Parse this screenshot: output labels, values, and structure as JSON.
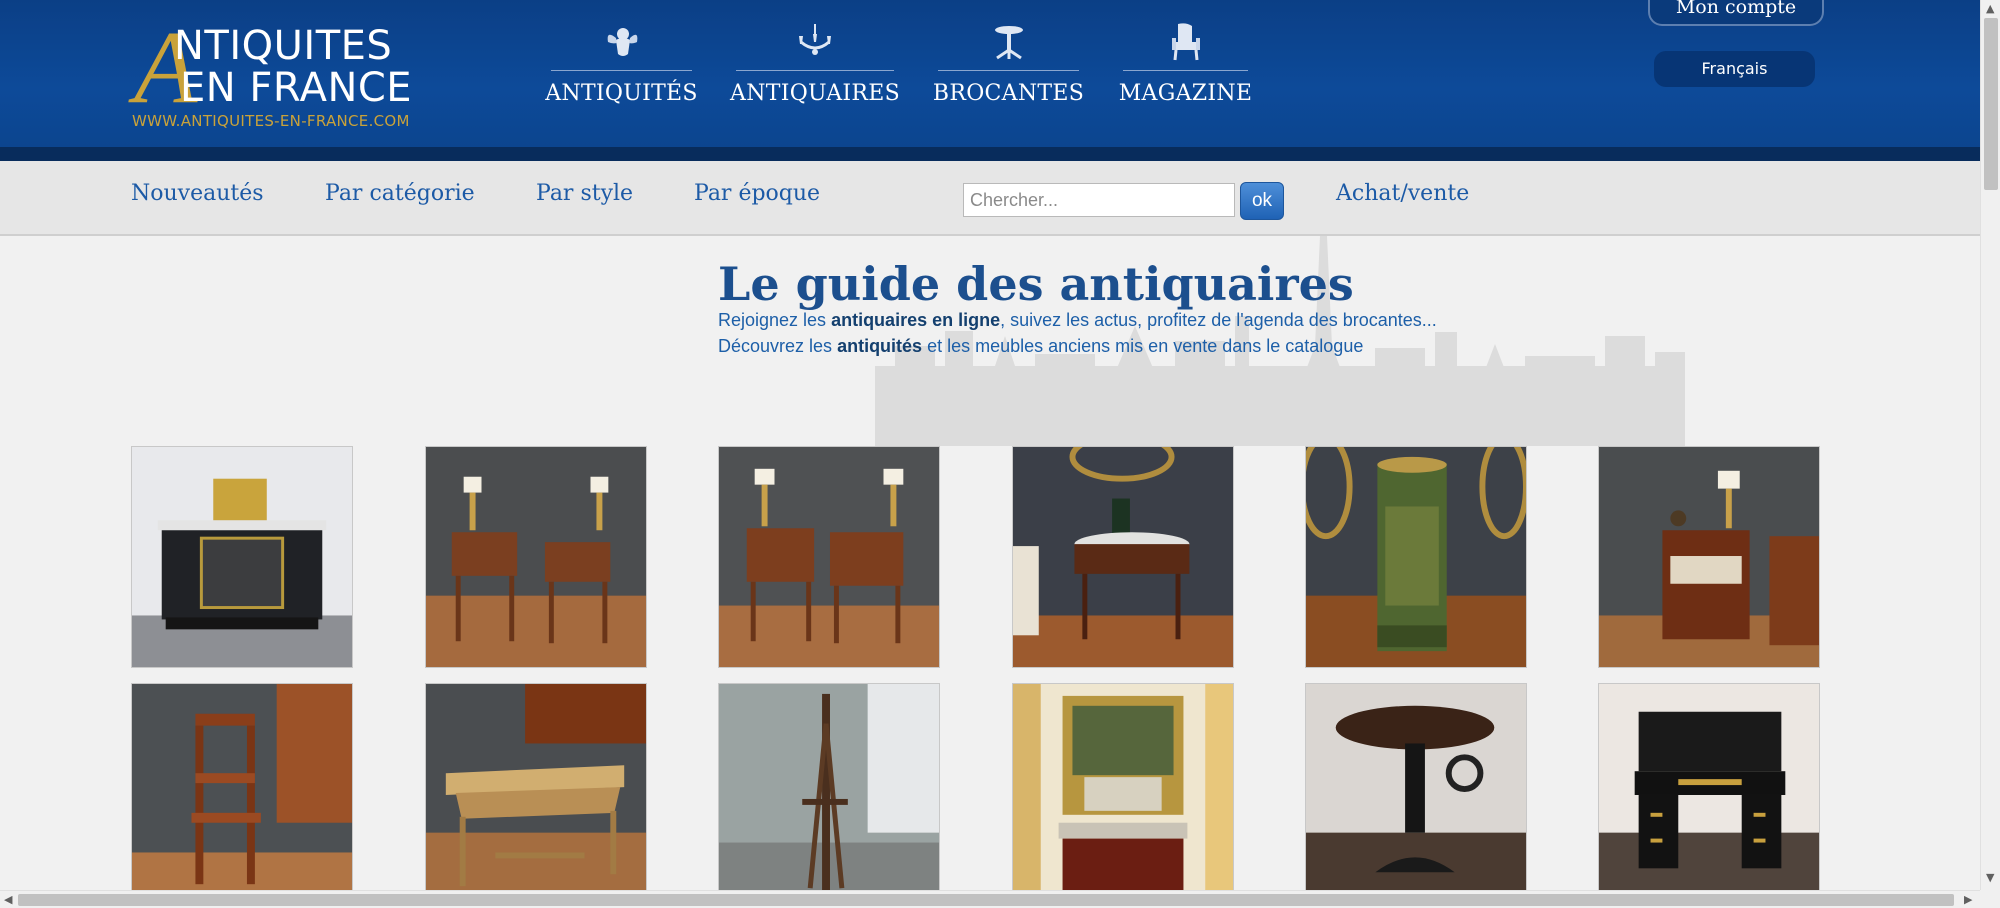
{
  "header": {
    "logo": {
      "line1": "NTIQUITES",
      "line2": "EN FRANCE",
      "url": "WWW.ANTIQUITES-EN-FRANCE.COM"
    },
    "nav": [
      {
        "label": "ANTIQUITÉS",
        "icon": "cherub-icon"
      },
      {
        "label": "ANTIQUAIRES",
        "icon": "chandelier-icon"
      },
      {
        "label": "BROCANTES",
        "icon": "gueridon-icon"
      },
      {
        "label": "MAGAZINE",
        "icon": "armchair-icon"
      }
    ],
    "account_label": "Mon compte",
    "language": "Français"
  },
  "subnav": {
    "links": [
      "Nouveautés",
      "Par catégorie",
      "Par style",
      "Par époque"
    ],
    "search_placeholder": "Chercher...",
    "search_button": "ok",
    "achat_vente": "Achat/vente"
  },
  "guide": {
    "title": "Le guide des antiquaires",
    "line1_a": "Rejoignez les ",
    "line1_b": "antiquaires en ligne",
    "line1_c": ", suivez les actus, profitez de l'agenda des brocantes...",
    "line2_a": "Découvrez les ",
    "line2_b": "antiquités",
    "line2_c": " et les meubles anciens mis en vente dans le catalogue"
  },
  "products": [
    {
      "name": "boulle-credenza-photo"
    },
    {
      "name": "pair-bedside-tables-photo-1"
    },
    {
      "name": "pair-bedside-tables-photo-2"
    },
    {
      "name": "round-console-table-photo"
    },
    {
      "name": "painted-umbrella-stand-photo"
    },
    {
      "name": "mahogany-side-cabinet-photo"
    },
    {
      "name": "library-step-chair-photo"
    },
    {
      "name": "carved-oak-table-photo"
    },
    {
      "name": "painter-easel-photo"
    },
    {
      "name": "painted-trumeau-commode-photo"
    },
    {
      "name": "industrial-crank-table-photo"
    },
    {
      "name": "black-lacquer-desk-photo"
    }
  ]
}
